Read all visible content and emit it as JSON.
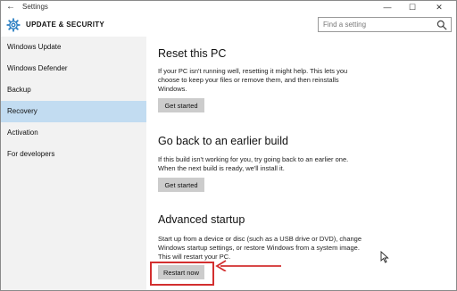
{
  "window": {
    "title": "Settings",
    "back_glyph": "←",
    "controls": {
      "minimize": "—",
      "maximize": "☐",
      "close": "✕"
    }
  },
  "header": {
    "title": "UPDATE & SECURITY",
    "icon": "gear-icon",
    "search_placeholder": "Find a setting"
  },
  "sidebar": {
    "items": [
      {
        "label": "Windows Update",
        "active": false
      },
      {
        "label": "Windows Defender",
        "active": false
      },
      {
        "label": "Backup",
        "active": false
      },
      {
        "label": "Recovery",
        "active": true
      },
      {
        "label": "Activation",
        "active": false
      },
      {
        "label": "For developers",
        "active": false
      }
    ]
  },
  "sections": [
    {
      "title": "Reset this PC",
      "description": "If your PC isn't running well, resetting it might help. This lets you choose to keep your files or remove them, and then reinstalls Windows.",
      "button": "Get started"
    },
    {
      "title": "Go back to an earlier build",
      "description": "If this build isn't working for you, try going back to an earlier one. When the next build is ready, we'll install it.",
      "button": "Get started"
    },
    {
      "title": "Advanced startup",
      "description": "Start up from a device or disc (such as a USB drive or DVD), change Windows startup settings, or restore Windows from a system image. This will restart your PC.",
      "button": "Restart now"
    }
  ],
  "colors": {
    "sidebar_bg": "#f2f2f2",
    "active_bg": "#c2dcf1",
    "highlight": "#d32f2f",
    "accent": "#2b7fc2"
  }
}
